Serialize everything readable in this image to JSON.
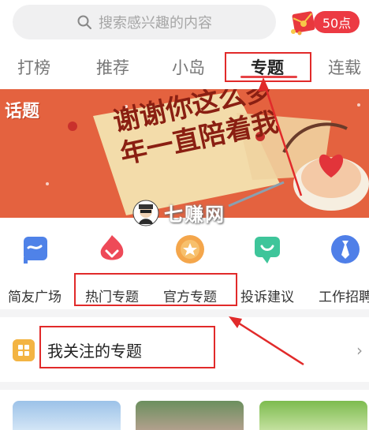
{
  "search": {
    "placeholder": "搜索感兴趣的内容"
  },
  "points": {
    "label": "50点"
  },
  "tabs": [
    {
      "label": "打榜"
    },
    {
      "label": "推荐"
    },
    {
      "label": "小岛"
    },
    {
      "label": "专题"
    },
    {
      "label": "连载"
    }
  ],
  "banner": {
    "tag": "话题",
    "headline": "谢谢你这么多年一直陪着我"
  },
  "watermark": {
    "text": "七赚网"
  },
  "shortcuts": [
    {
      "label": "简友广场",
      "icon": "flag-icon"
    },
    {
      "label": "热门专题",
      "icon": "flame-icon"
    },
    {
      "label": "官方专题",
      "icon": "star-badge-icon"
    },
    {
      "label": "投诉建议",
      "icon": "chat-icon"
    },
    {
      "label": "工作招聘",
      "icon": "tie-icon"
    }
  ],
  "follow": {
    "label": "我关注的专题"
  },
  "colors": {
    "accent": "#e64346",
    "annotation": "#e12a2a"
  }
}
